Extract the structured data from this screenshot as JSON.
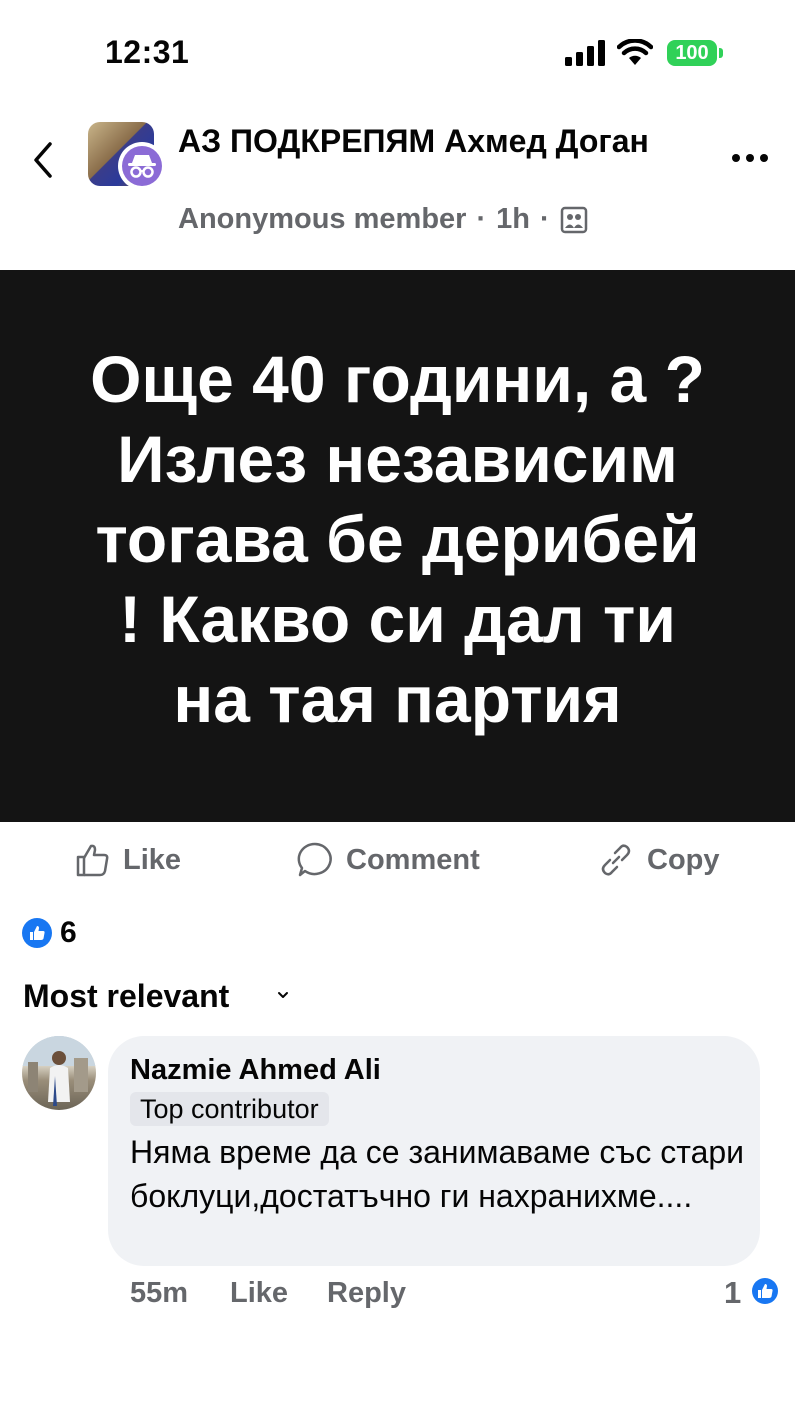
{
  "status_bar": {
    "time": "12:31",
    "battery": "100"
  },
  "header": {
    "group_name": "АЗ ПОДКРЕПЯМ Ахмед Доган",
    "author": "Anonymous member",
    "separator": "·",
    "time": "1h"
  },
  "post": {
    "text": "Още 40 години, а ?\nИзлез независим\nтогава бе дерибей\n!  Какво си дал ти\nна тая партия",
    "background_color": "#141414"
  },
  "actions": {
    "like": "Like",
    "comment": "Comment",
    "copy": "Copy"
  },
  "reactions": {
    "count": "6",
    "icon": "like-icon",
    "color": "#1877f2"
  },
  "sort": {
    "label": "Most relevant"
  },
  "comment": {
    "author": "Nazmie Ahmed Ali",
    "badge": "Top contributor",
    "text": "Няма време да се занимаваме със стари боклуци,достатъчно ги нахранихме....",
    "time": "55m",
    "like": "Like",
    "reply": "Reply",
    "reaction_count": "1"
  }
}
